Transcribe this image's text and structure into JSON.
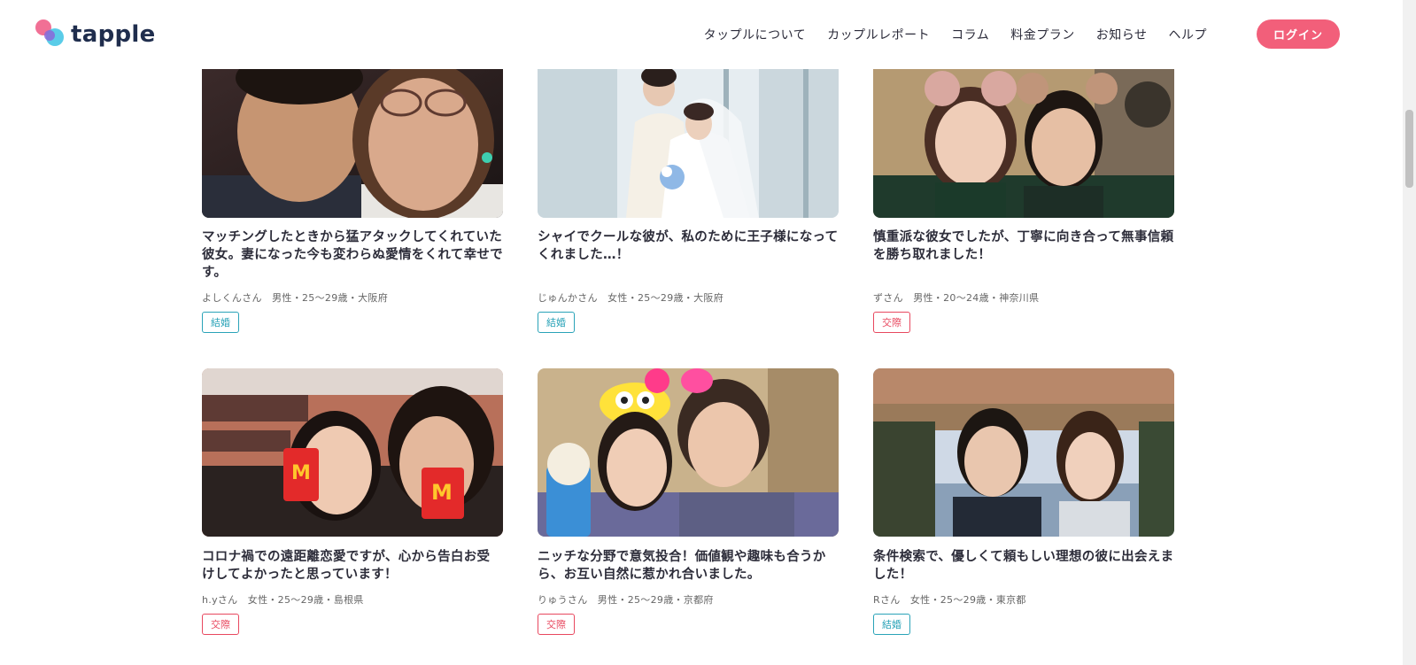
{
  "brand": {
    "name": "tapple"
  },
  "nav": {
    "items": [
      "タップルについて",
      "カップルレポート",
      "コラム",
      "料金プラン",
      "お知らせ",
      "ヘルプ"
    ],
    "login_label": "ログイン"
  },
  "colors": {
    "accent": "#f25f7a",
    "tag_marry": "#2aa3b8",
    "tag_date": "#e8485f",
    "text": "#2d2d3a"
  },
  "cards": [
    {
      "title": "マッチングしたときから猛アタックしてくれていた彼女。妻になった今も変わらぬ愛情をくれて幸せです。",
      "meta": "よしくんさん　男性・25〜29歳・大阪府",
      "tag": "結婚"
    },
    {
      "title": "シャイでクールな彼が、私のために王子様になってくれました…！",
      "meta": "じゅんかさん　女性・25〜29歳・大阪府",
      "tag": "結婚"
    },
    {
      "title": "慎重派な彼女でしたが、丁寧に向き合って無事信頼を勝ち取れました！",
      "meta": "ずさん　男性・20〜24歳・神奈川県",
      "tag": "交際"
    },
    {
      "title": "コロナ禍での遠距離恋愛ですが、心から告白お受けしてよかったと思っています！",
      "meta": "h.yさん　女性・25〜29歳・島根県",
      "tag": "交際"
    },
    {
      "title": "ニッチな分野で意気投合！価値観や趣味も合うから、お互い自然に惹かれ合いました。",
      "meta": "りゅうさん　男性・25〜29歳・京都府",
      "tag": "交際"
    },
    {
      "title": "条件検索で、優しくて頼もしい理想の彼に出会えました！",
      "meta": "Rさん　女性・25〜29歳・東京都",
      "tag": "結婚"
    }
  ]
}
